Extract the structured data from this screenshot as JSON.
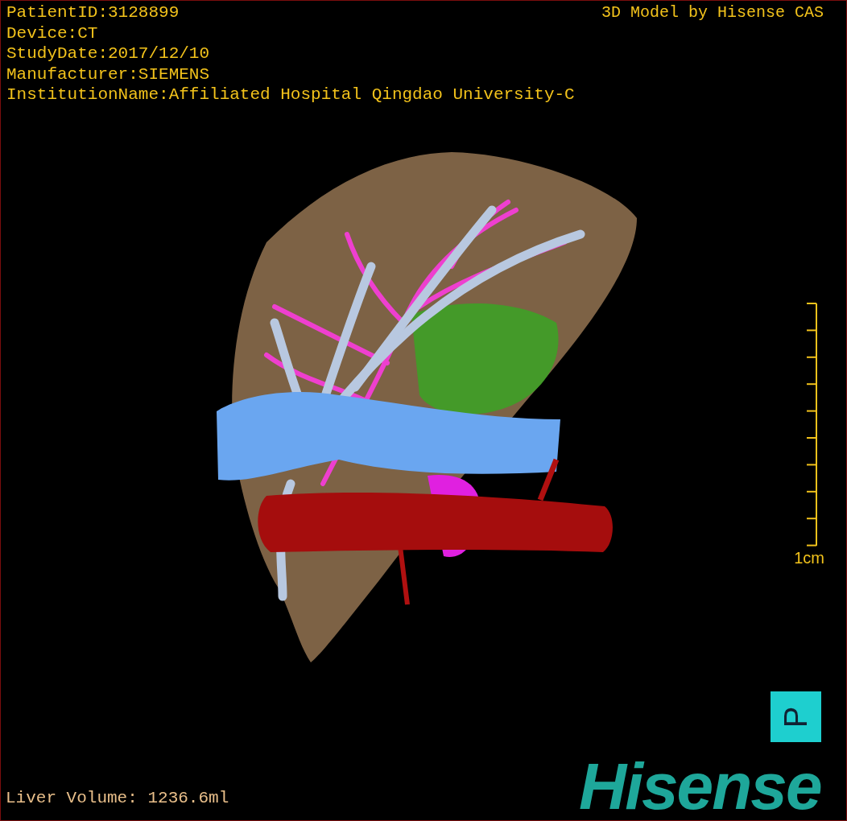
{
  "info_lines": [
    "PatientID:3128899",
    "Device:CT",
    "StudyDate:2017/12/10",
    "Manufacturer:SIEMENS",
    "InstitutionName:Affiliated Hospital Qingdao University-C"
  ],
  "model_credit": "3D Model by Hisense CAS",
  "scale_bar": {
    "label": "1cm"
  },
  "orientation_label": "P",
  "liver_volume": "Liver Volume: 1236.6ml",
  "logo": "Hisense"
}
